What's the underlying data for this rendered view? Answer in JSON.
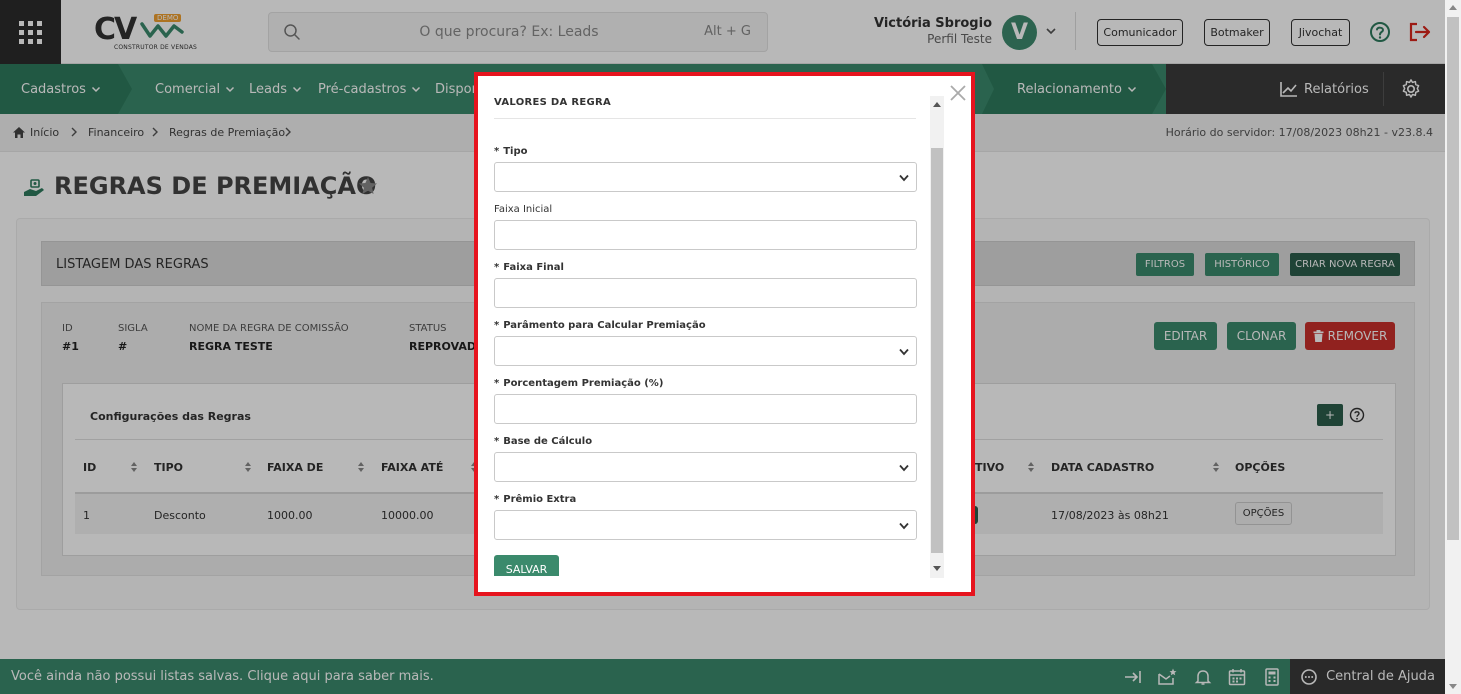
{
  "header": {
    "logo_text": "CV",
    "logo_badge": "DEMO",
    "logo_subtitle": "CONSTRUTOR DE VENDAS",
    "search_placeholder": "O que procura? Ex: Leads",
    "search_shortcut": "Alt + G",
    "user_name": "Victória Sbrogio",
    "user_profile": "Perfil Teste",
    "avatar_initial": "V",
    "buttons": [
      "Comunicador",
      "Botmaker",
      "Jivochat"
    ]
  },
  "nav": {
    "items": [
      "Cadastros",
      "Comercial",
      "Leads",
      "Pré-cadastros",
      "Dispon",
      "Relacionamento"
    ],
    "reports": "Relatórios"
  },
  "breadcrumb": {
    "items": [
      "Início",
      "Financeiro",
      "Regras de Premiação"
    ],
    "server_time": "Horário do servidor: 17/08/2023 08h21 - v23.8.4"
  },
  "page": {
    "title": "REGRAS DE PREMIAÇÃO",
    "list_title": "LISTAGEM DAS REGRAS",
    "header_buttons": {
      "filters": "FILTROS",
      "history": "HISTÓRICO",
      "create": "CRIAR NOVA REGRA"
    }
  },
  "rule": {
    "labels": {
      "id": "ID",
      "sigla": "SIGLA",
      "name": "NOME DA REGRA DE COMISSÃO",
      "status": "STATUS"
    },
    "values": {
      "id": "#1",
      "sigla": "#",
      "name": "REGRA TESTE",
      "status": "REPROVADO"
    },
    "actions": {
      "edit": "EDITAR",
      "clone": "CLONAR",
      "remove": "REMOVER"
    }
  },
  "config": {
    "title": "Configurações das Regras",
    "add_label": "+",
    "columns": [
      "ID",
      "TIPO",
      "FAIXA DE",
      "FAIXA ATÉ",
      "TIVO",
      "DATA CADASTRO",
      "OPÇÕES"
    ],
    "rows": [
      {
        "id": "1",
        "tipo": "Desconto",
        "faixa_de": "1000.00",
        "faixa_ate": "10000.00",
        "data_cadastro": "17/08/2023 às 08h21",
        "opcoes": "OPÇÕES"
      }
    ]
  },
  "footer": {
    "message": "Você ainda não possui listas salvas. Clique aqui para saber mais.",
    "help_center": "Central de Ajuda"
  },
  "modal": {
    "heading": "VALORES DA REGRA",
    "fields": [
      {
        "label": "Tipo",
        "required": true,
        "type": "select",
        "value": ""
      },
      {
        "label": "Faixa Inicial",
        "required": false,
        "type": "text",
        "value": ""
      },
      {
        "label": "Faixa Final",
        "required": true,
        "type": "text",
        "value": ""
      },
      {
        "label": "Parâmento para Calcular Premiação",
        "required": true,
        "type": "select",
        "value": ""
      },
      {
        "label": "Porcentagem Premiação (%)",
        "required": true,
        "type": "text",
        "value": ""
      },
      {
        "label": "Base de Cálculo",
        "required": true,
        "type": "select",
        "value": ""
      },
      {
        "label": "Prêmio Extra",
        "required": true,
        "type": "select",
        "value": ""
      }
    ],
    "required_marker": "*",
    "save_label": "SALVAR"
  },
  "colors": {
    "primary_green": "#3b8a6c",
    "dark_green": "#2c5d4b",
    "danger_red": "#c9302c",
    "highlight_red": "#e6141e"
  }
}
